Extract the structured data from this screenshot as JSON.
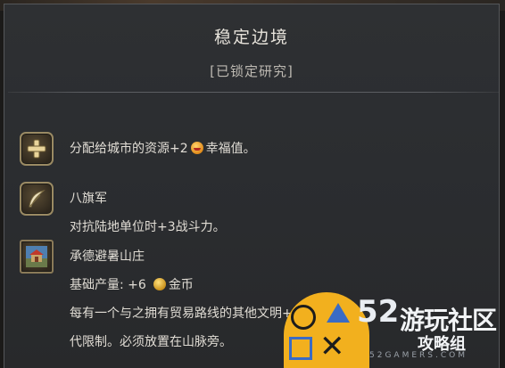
{
  "header": {
    "title": "稳定边境",
    "status": "[已锁定研究]"
  },
  "bonuses": [
    {
      "icon": "plus-icon",
      "text_before": "分配给城市的资源+2",
      "text_after": "幸福值。"
    },
    {
      "icon": "feather-icon",
      "name": "八旗军",
      "description": "对抗陆地单位时+3战斗力。"
    },
    {
      "icon": "palace-icon",
      "name": "承德避暑山庄",
      "yield_label": "基础产量: +6",
      "yield_resource": "金币",
      "description_line1": "每有一个与之拥有贸易路线的其他文明+2金币，+",
      "description_line2": "代限制。必须放置在山脉旁。"
    }
  ],
  "watermark": {
    "number": "52",
    "name": "游玩社区",
    "sub": "攻略组",
    "url": "52GAMERS.COM"
  },
  "colors": {
    "accent_gold": "#9a8a63",
    "background": "#2e3033",
    "text": "#e0dcd4"
  }
}
